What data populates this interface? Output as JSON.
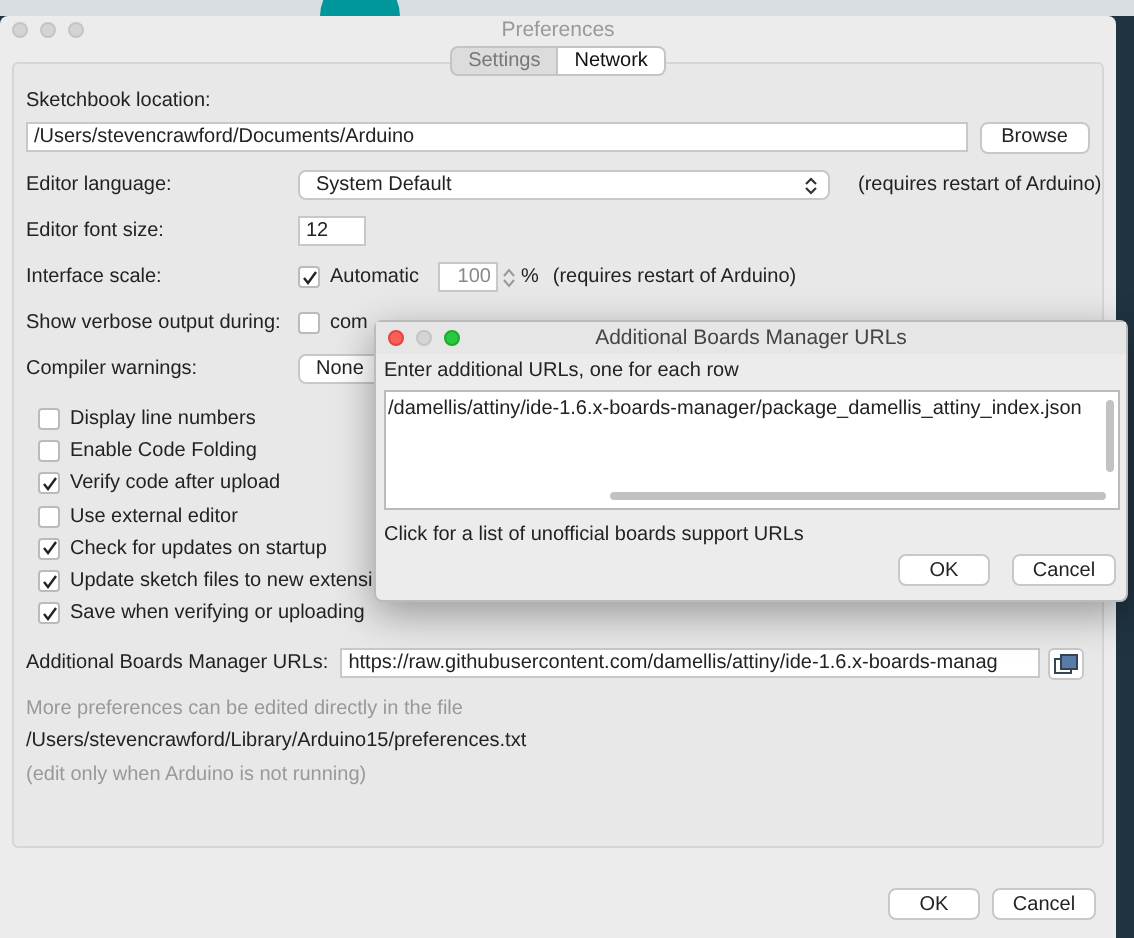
{
  "window": {
    "title": "Preferences"
  },
  "tabs": [
    {
      "label": "Settings",
      "selected": true
    },
    {
      "label": "Network",
      "selected": false
    }
  ],
  "sketchbook": {
    "label": "Sketchbook location:",
    "value": "/Users/stevencrawford/Documents/Arduino",
    "button": "Browse"
  },
  "editor_language": {
    "label": "Editor language:",
    "value": "System Default",
    "note": "(requires restart of Arduino)"
  },
  "editor_font_size": {
    "label": "Editor font size:",
    "value": "12"
  },
  "interface_scale": {
    "label": "Interface scale:",
    "checkbox_label": "Automatic",
    "checked": true,
    "value": "100",
    "unit": "%",
    "note": "(requires restart of Arduino)"
  },
  "verbose": {
    "label": "Show verbose output during:",
    "checkbox_label": "com",
    "checked": false
  },
  "compiler_warnings": {
    "label": "Compiler warnings:",
    "value": "None"
  },
  "options": [
    {
      "label": "Display line numbers",
      "checked": false
    },
    {
      "label": "Enable Code Folding",
      "checked": false
    },
    {
      "label": "Verify code after upload",
      "checked": true
    },
    {
      "label": "Use external editor",
      "checked": false
    },
    {
      "label": "Check for updates on startup",
      "checked": true
    },
    {
      "label": "Update sketch files to new extensi",
      "checked": true
    },
    {
      "label": "Save when verifying or uploading",
      "checked": true
    }
  ],
  "boards_urls": {
    "label": "Additional Boards Manager URLs:",
    "value": "https://raw.githubusercontent.com/damellis/attiny/ide-1.6.x-boards-manag"
  },
  "file_info": {
    "hint": "More preferences can be edited directly in the file",
    "path": "/Users/stevencrawford/Library/Arduino15/preferences.txt",
    "note": "(edit only when Arduino is not running)"
  },
  "buttons": [
    "OK",
    "Cancel"
  ],
  "dialog": {
    "title": "Additional Boards Manager URLs",
    "prompt": "Enter additional URLs, one for each row",
    "urls": "/damellis/attiny/ide-1.6.x-boards-manager/package_damellis_attiny_index.json",
    "link": "Click for a list of unofficial boards support URLs",
    "buttons": [
      "OK",
      "Cancel"
    ]
  }
}
